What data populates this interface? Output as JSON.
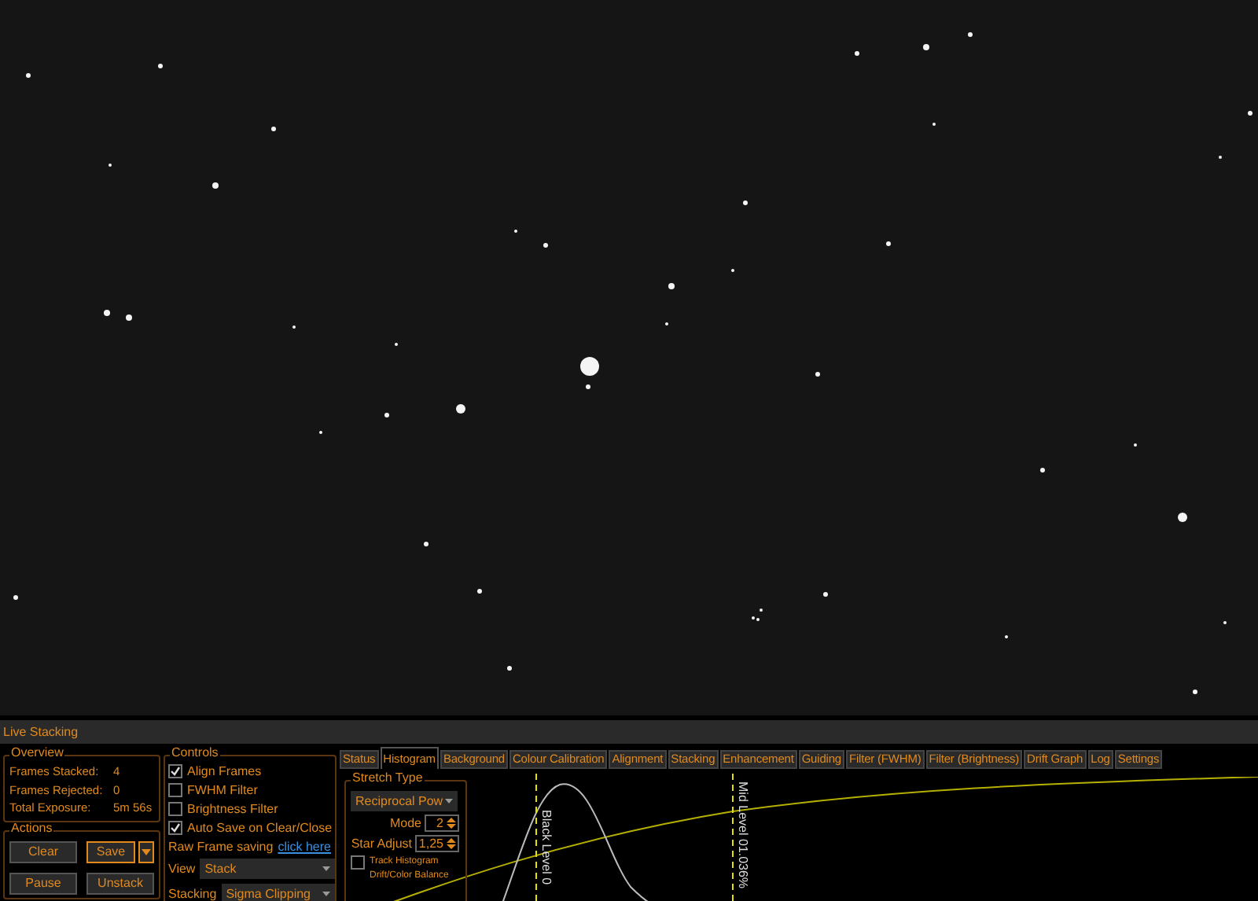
{
  "title": "Live Stacking",
  "overview": {
    "label": "Overview",
    "rows": [
      {
        "label": "Frames Stacked:",
        "value": "4"
      },
      {
        "label": "Frames Rejected:",
        "value": "0"
      },
      {
        "label": "Total Exposure:",
        "value": "5m 56s"
      }
    ]
  },
  "actions": {
    "label": "Actions",
    "buttons": [
      {
        "label": "Clear",
        "kind": "plain"
      },
      {
        "label": "Save",
        "kind": "split"
      },
      {
        "label": "Pause",
        "kind": "plain"
      },
      {
        "label": "Unstack",
        "kind": "plain"
      }
    ]
  },
  "controls": {
    "label": "Controls",
    "checkboxes": [
      {
        "label": "Align Frames",
        "checked": true
      },
      {
        "label": "FWHM Filter",
        "checked": false
      },
      {
        "label": "Brightness Filter",
        "checked": false
      },
      {
        "label": "Auto Save on Clear/Close",
        "checked": true
      }
    ],
    "raw_frame": {
      "label": "Raw Frame saving",
      "link": "click here"
    },
    "view": {
      "label": "View",
      "value": "Stack"
    },
    "stacking": {
      "label": "Stacking",
      "value": "Sigma Clipping"
    }
  },
  "tabs": [
    {
      "label": "Status",
      "selected": false
    },
    {
      "label": "Histogram",
      "selected": true
    },
    {
      "label": "Background",
      "selected": false
    },
    {
      "label": "Colour Calibration",
      "selected": false
    },
    {
      "label": "Alignment",
      "selected": false
    },
    {
      "label": "Stacking",
      "selected": false
    },
    {
      "label": "Enhancement",
      "selected": false
    },
    {
      "label": "Guiding",
      "selected": false
    },
    {
      "label": "Filter (FWHM)",
      "selected": false
    },
    {
      "label": "Filter (Brightness)",
      "selected": false
    },
    {
      "label": "Drift Graph",
      "selected": false
    },
    {
      "label": "Log",
      "selected": false
    },
    {
      "label": "Settings",
      "selected": false
    }
  ],
  "stretch": {
    "label": "Stretch Type",
    "type": "Reciprocal Pow",
    "mode": {
      "label": "Mode",
      "value": "2"
    },
    "star_adjust": {
      "label": "Star Adjust",
      "value": "1,25"
    },
    "track": {
      "label": "Track Histogram Drift/Color Balance",
      "checked": false
    }
  },
  "histogram": {
    "black_level": "Black Level 0",
    "mid_level": "Mid Level 01.036%"
  }
}
